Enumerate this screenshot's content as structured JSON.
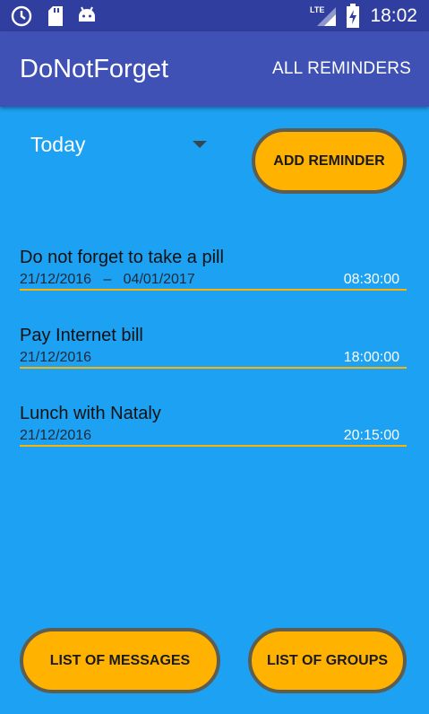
{
  "status_bar": {
    "time": "18:02",
    "icons": [
      "clock-icon",
      "sd-card-icon",
      "android-icon",
      "lte-signal-icon",
      "battery-icon"
    ]
  },
  "app_bar": {
    "title": "DoNotForget",
    "all_reminders_label": "ALL REMINDERS"
  },
  "filter": {
    "selected": "Today"
  },
  "buttons": {
    "add_reminder": "ADD REMINDER",
    "list_of_messages": "LIST OF MESSAGES",
    "list_of_groups": "LIST OF GROUPS"
  },
  "reminders": [
    {
      "title": "Do not forget to take a pill",
      "dates": "21/12/2016   –   04/01/2017",
      "time": "08:30:00"
    },
    {
      "title": "Pay Internet bill",
      "dates": "21/12/2016",
      "time": "18:00:00"
    },
    {
      "title": "Lunch with Nataly",
      "dates": "21/12/2016",
      "time": "20:15:00"
    }
  ],
  "colors": {
    "background": "#1da1f2",
    "app_bar": "#3f51b5",
    "status_bar": "#303f9f",
    "accent": "#ffb300"
  }
}
